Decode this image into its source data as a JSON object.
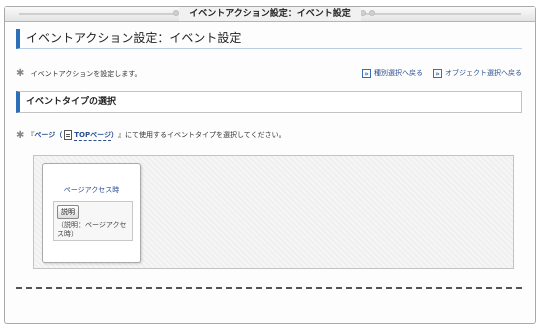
{
  "window": {
    "title": "イベントアクション設定：イベント設定"
  },
  "page": {
    "heading": "イベントアクション設定：イベント設定",
    "description": "イベントアクションを設定します。"
  },
  "nav": {
    "back_to_type": "種別選択へ戻る",
    "back_to_object": "オブジェクト選択へ戻る"
  },
  "section": {
    "title": "イベントタイプの選択"
  },
  "instruction": {
    "prefix": "『",
    "page_label": "ページ",
    "open_paren": "（",
    "top_page_label": "TOPページ",
    "close_paren": "）",
    "suffix": "』にて使用するイベントタイプを選択してください。"
  },
  "event_types": [
    {
      "name": "ページアクセス時",
      "desc_button": "説明",
      "desc_text": "（説明：ページアクセス時）"
    }
  ]
}
